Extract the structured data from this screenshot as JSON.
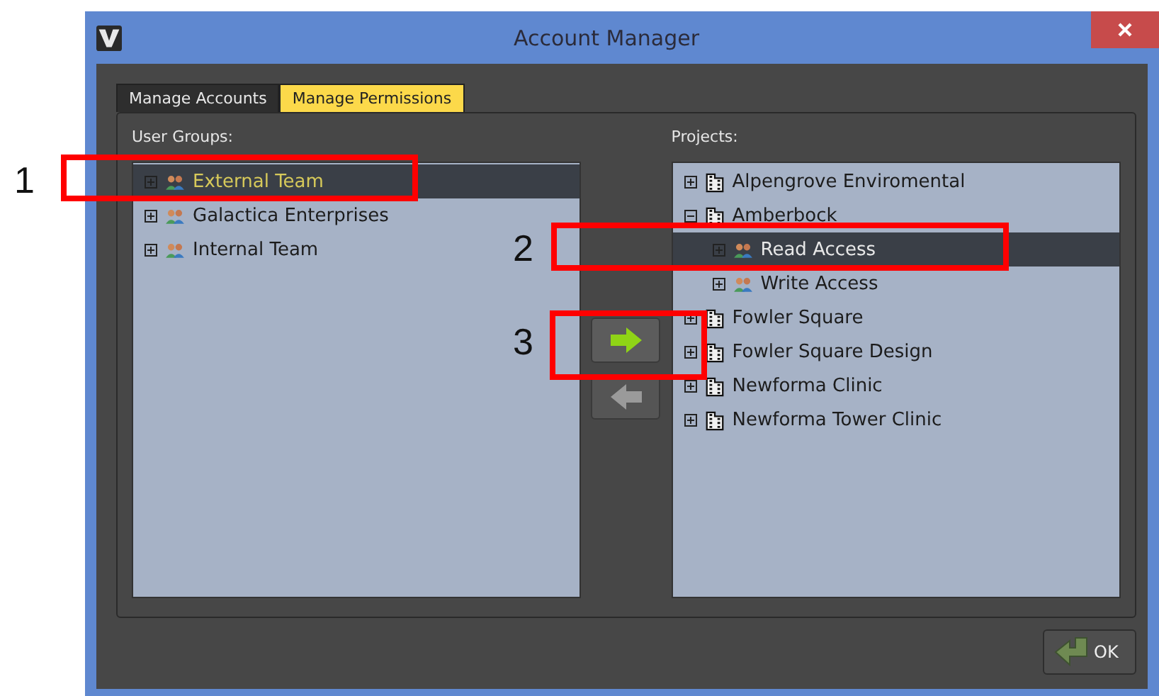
{
  "window": {
    "title": "Account Manager"
  },
  "tabs": [
    {
      "label": "Manage Accounts",
      "selected": false
    },
    {
      "label": "Manage Permissions",
      "selected": true
    }
  ],
  "user_groups": {
    "label": "User Groups:",
    "items": [
      {
        "label": "External Team",
        "kind": "group",
        "selected": true,
        "expanded": false
      },
      {
        "label": "Galactica Enterprises",
        "kind": "group",
        "selected": false,
        "expanded": false
      },
      {
        "label": "Internal Team",
        "kind": "group",
        "selected": false,
        "expanded": false
      }
    ]
  },
  "move_buttons": [
    {
      "kind": "add",
      "disabled": false
    },
    {
      "kind": "remove",
      "disabled": true
    }
  ],
  "projects": {
    "label": "Projects:",
    "items": [
      {
        "label": "Alpengrove Enviromental",
        "kind": "project",
        "selected": false,
        "expanded": false
      },
      {
        "label": "Amberbock",
        "kind": "project",
        "selected": false,
        "expanded": true,
        "children": [
          {
            "label": "Read Access",
            "kind": "group",
            "selected": true,
            "expanded": false
          },
          {
            "label": "Write Access",
            "kind": "group",
            "selected": false,
            "expanded": false
          }
        ]
      },
      {
        "label": "Fowler Square",
        "kind": "project",
        "selected": false,
        "expanded": false
      },
      {
        "label": "Fowler Square Design",
        "kind": "project",
        "selected": false,
        "expanded": false
      },
      {
        "label": "Newforma Clinic",
        "kind": "project",
        "selected": false,
        "expanded": false
      },
      {
        "label": "Newforma Tower Clinic",
        "kind": "project",
        "selected": false,
        "expanded": false
      }
    ]
  },
  "ok_button": {
    "label": "OK"
  },
  "callouts": [
    {
      "label": "1"
    },
    {
      "label": "2"
    },
    {
      "label": "3"
    }
  ]
}
